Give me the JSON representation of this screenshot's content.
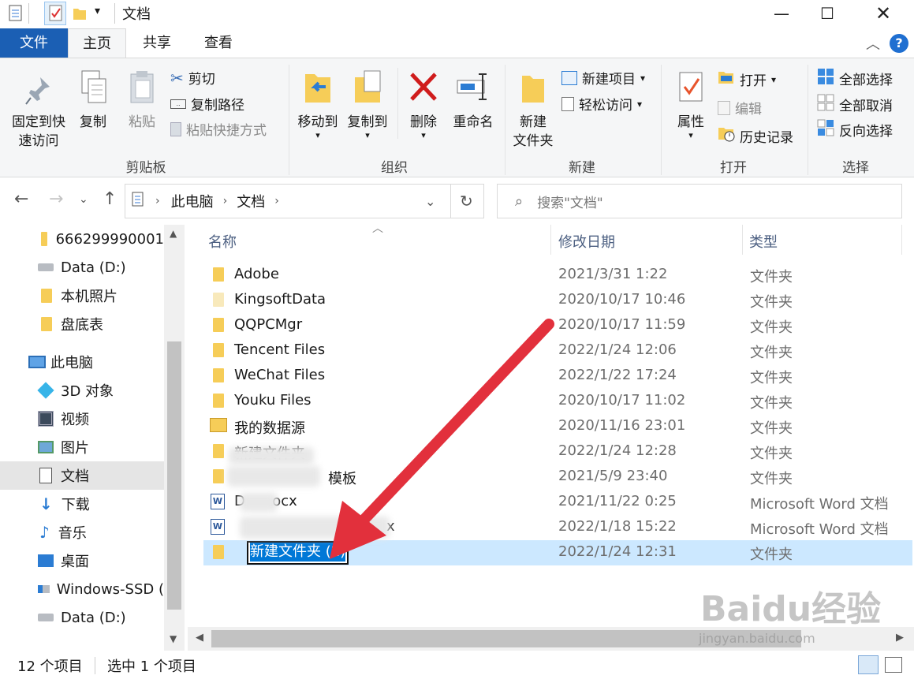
{
  "window": {
    "title": "文档",
    "folder_sep": "|"
  },
  "tabs": {
    "file": "文件",
    "home": "主页",
    "share": "共享",
    "view": "查看"
  },
  "ribbon": {
    "clipboard": {
      "label": "剪贴板",
      "pin": "固定到快\n速访问",
      "pin_line1": "固定到快",
      "pin_line2": "速访问",
      "copy": "复制",
      "paste": "粘贴",
      "cut": "剪切",
      "copy_path": "复制路径",
      "paste_shortcut": "粘贴快捷方式"
    },
    "organize": {
      "label": "组织",
      "move_to": "移动到",
      "copy_to": "复制到",
      "delete": "删除",
      "rename": "重命名"
    },
    "new": {
      "label": "新建",
      "new_folder_line1": "新建",
      "new_folder_line2": "文件夹",
      "new_item": "新建项目",
      "easy_access": "轻松访问"
    },
    "open": {
      "label": "打开",
      "properties": "属性",
      "open": "打开",
      "edit": "编辑",
      "history": "历史记录"
    },
    "select": {
      "label": "选择",
      "select_all": "全部选择",
      "select_none": "全部取消",
      "invert": "反向选择"
    }
  },
  "address": {
    "crumb1": "此电脑",
    "crumb2": "文档",
    "search_placeholder": "搜索\"文档\""
  },
  "nav": {
    "items": [
      {
        "label": "666299990001"
      },
      {
        "label": "Data (D:)"
      },
      {
        "label": "本机照片"
      },
      {
        "label": "盘底表"
      },
      {
        "label": "此电脑"
      },
      {
        "label": "3D 对象"
      },
      {
        "label": "视频"
      },
      {
        "label": "图片"
      },
      {
        "label": "文档"
      },
      {
        "label": "下载"
      },
      {
        "label": "音乐"
      },
      {
        "label": "桌面"
      },
      {
        "label": "Windows-SSD ("
      },
      {
        "label": "Data (D:)"
      }
    ]
  },
  "list": {
    "columns": {
      "name": "名称",
      "date": "修改日期",
      "type": "类型"
    },
    "rows": [
      {
        "name": "Adobe",
        "date": "2021/3/31 1:22",
        "type": "文件夹"
      },
      {
        "name": "KingsoftData",
        "date": "2020/10/17 10:46",
        "type": "文件夹"
      },
      {
        "name": "QQPCMgr",
        "date": "2020/10/17 11:59",
        "type": "文件夹"
      },
      {
        "name": "Tencent Files",
        "date": "2022/1/24 12:06",
        "type": "文件夹"
      },
      {
        "name": "WeChat Files",
        "date": "2022/1/22 17:24",
        "type": "文件夹"
      },
      {
        "name": "Youku Files",
        "date": "2020/10/17 11:02",
        "type": "文件夹"
      },
      {
        "name": "我的数据源",
        "date": "2020/11/16 23:01",
        "type": "文件夹"
      },
      {
        "name": "新建文件夹",
        "date": "2022/1/24 12:28",
        "type": "文件夹"
      },
      {
        "name": "模板",
        "date": "2021/5/9 23:40",
        "type": "文件夹"
      },
      {
        "name": "D      ocx",
        "date": "2021/11/22 0:25",
        "type": "Microsoft Word 文档"
      },
      {
        "name": "x",
        "date": "2022/1/18 15:22",
        "type": "Microsoft Word 文档"
      },
      {
        "name": "新建文件夹 (2)",
        "date": "2022/1/24 12:31",
        "type": "文件夹"
      }
    ]
  },
  "status": {
    "count": "12 个项目",
    "selected": "选中 1 个项目"
  },
  "watermark": {
    "brand": "Baidu经验",
    "url": "jingyan.baidu.com"
  }
}
